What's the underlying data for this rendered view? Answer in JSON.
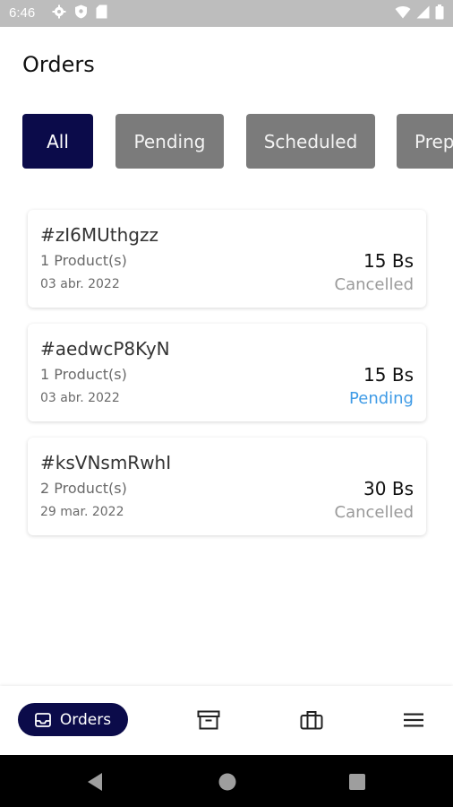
{
  "status_bar": {
    "time": "6:46"
  },
  "header": {
    "title": "Orders"
  },
  "filters": [
    {
      "label": "All",
      "active": true
    },
    {
      "label": "Pending",
      "active": false
    },
    {
      "label": "Scheduled",
      "active": false
    },
    {
      "label": "Prep",
      "active": false
    }
  ],
  "orders": [
    {
      "id": "#zI6MUthgzz",
      "products": "1 Product(s)",
      "date": "03 abr. 2022",
      "price": "15 Bs",
      "status": "Cancelled"
    },
    {
      "id": "#aedwcP8KyN",
      "products": "1 Product(s)",
      "date": "03 abr. 2022",
      "price": "15 Bs",
      "status": "Pending"
    },
    {
      "id": "#ksVNsmRwhI",
      "products": "2 Product(s)",
      "date": "29 mar. 2022",
      "price": "30 Bs",
      "status": "Cancelled"
    }
  ],
  "bottom_nav": {
    "orders_label": "Orders"
  },
  "colors": {
    "accent": "#0b0b4a",
    "pending": "#3f9be6",
    "muted": "#9a9a9a",
    "chip_inactive": "#7b7b7b"
  },
  "icons": [
    "settings-icon",
    "shield-icon",
    "sd-card-icon",
    "wifi-icon",
    "signal-icon",
    "battery-icon",
    "inbox-icon",
    "archive-icon",
    "briefcase-icon",
    "menu-icon",
    "back-icon",
    "home-icon",
    "recents-icon"
  ]
}
